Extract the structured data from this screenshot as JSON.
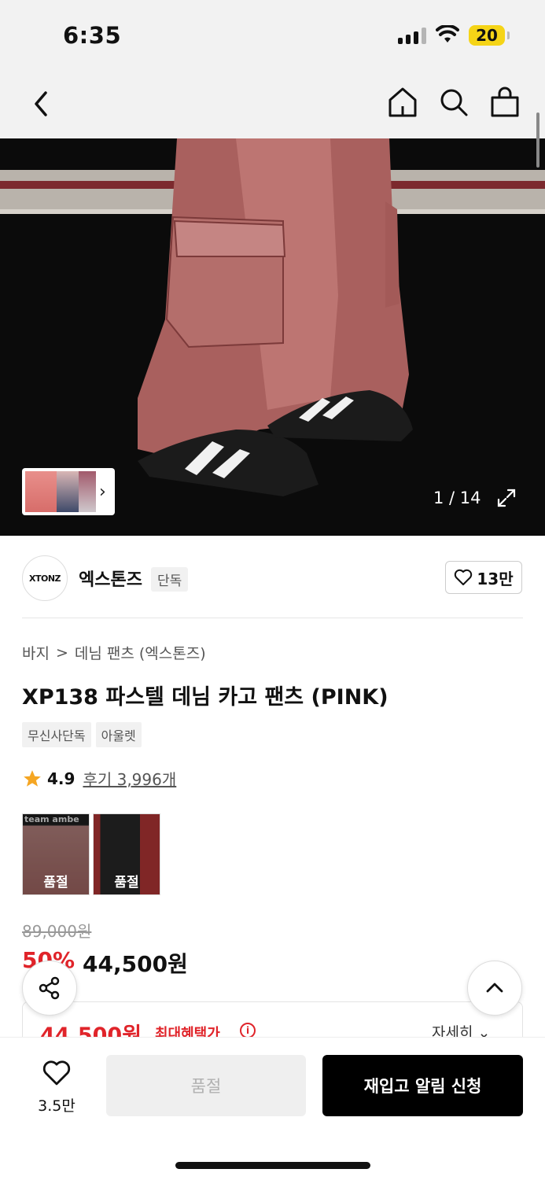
{
  "status": {
    "time": "6:35",
    "battery": "20"
  },
  "header": {
    "back_icon": "chevron-left-icon",
    "home_icon": "home-icon",
    "search_icon": "search-icon",
    "bag_icon": "shopping-bag-icon"
  },
  "gallery": {
    "counter": "1 / 14",
    "current": 1,
    "total": 14
  },
  "brand": {
    "logo_text": "XTONZ",
    "name": "엑스톤즈",
    "tag": "단독",
    "likes": "13만"
  },
  "breadcrumb": {
    "category": "바지",
    "separator": ">",
    "subcategory": "데님 팬츠 (엑스톤즈)"
  },
  "product": {
    "title": "XP138 파스텔 데님 카고 팬츠 (PINK)",
    "badges": [
      "무신사단독",
      "아울렛"
    ]
  },
  "rating": {
    "score": "4.9",
    "reviews": "후기 3,996개"
  },
  "colors": [
    {
      "sold_label": "품절"
    },
    {
      "sold_label": "품절"
    }
  ],
  "price": {
    "original": "89,000원",
    "discount": "50%",
    "sale": "44,500원",
    "benefit_price": "44,500원",
    "benefit_label": "최대혜택가",
    "details": "자세히"
  },
  "bottom": {
    "wish_count": "3.5만",
    "sold_out": "품절",
    "restock": "재입고 알림 신청"
  },
  "colors_theme": {
    "accent_red": "#e0242a",
    "black": "#000000"
  }
}
